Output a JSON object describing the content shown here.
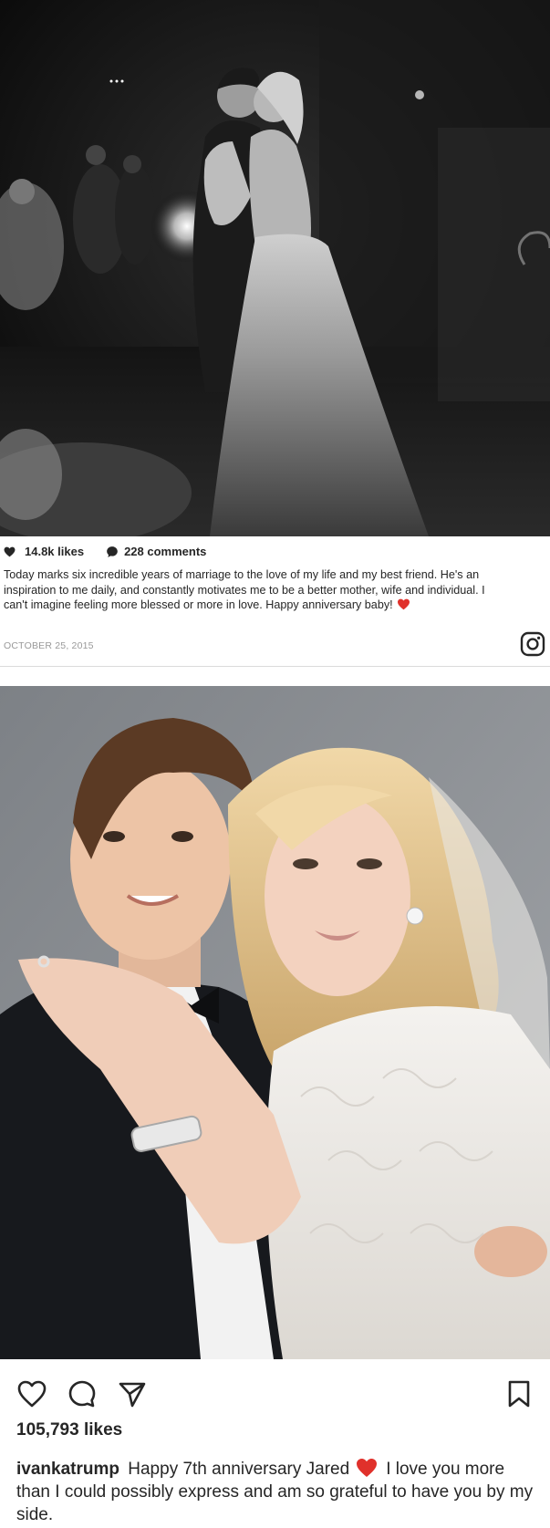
{
  "top_post": {
    "likes_count": "14.8k likes",
    "comments_count": "228 comments",
    "caption_text": "Today marks six incredible years of marriage to the love of my life and my best friend. He's an inspiration to me daily, and constantly motivates me to be a better mother, wife and individual. I can't imagine feeling more blessed or more in love. Happy anniversary baby!",
    "date": "OCTOBER 25, 2015",
    "icons": {
      "likes": "heart-icon",
      "comments": "comment-bubble-icon",
      "caption_emoji": "red-heart-emoji-icon",
      "brand": "instagram-logo-icon"
    }
  },
  "bottom_post": {
    "likes_count": "105,793 likes",
    "username": "ivankatrump",
    "caption_before_emoji": "Happy 7th anniversary Jared",
    "caption_after_emoji": "I love you more than I could possibly express and am so grateful to have you by my side.",
    "icons": {
      "like": "heart-outline-icon",
      "comment": "comment-outline-icon",
      "share": "send-paper-plane-icon",
      "save": "bookmark-outline-icon",
      "caption_emoji": "red-heart-emoji-icon"
    }
  },
  "colors": {
    "text": "#262626",
    "muted": "#999999",
    "heart_red": "#e0312b",
    "divider": "#dbdbdb"
  }
}
